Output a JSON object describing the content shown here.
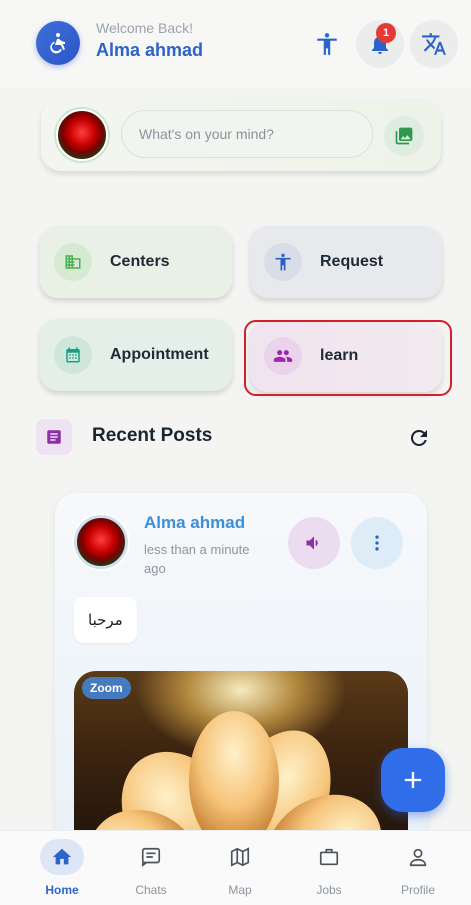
{
  "header": {
    "welcome": "Welcome Back!",
    "username": "Alma ahmad",
    "notification_count": "1",
    "icons": {
      "avatar": "wheelchair-icon",
      "accessibility": "accessibility-icon",
      "notifications": "bell-icon",
      "translate": "translate-icon"
    }
  },
  "composer": {
    "placeholder": "What's on your mind?",
    "photo_icon": "image-icon"
  },
  "quick_actions": [
    {
      "label": "Centers",
      "icon": "building-icon",
      "color": "#4caf50"
    },
    {
      "label": "Request",
      "icon": "accessibility-icon",
      "color": "#2d5fc4"
    },
    {
      "label": "Appointment",
      "icon": "calendar-icon",
      "color": "#16a085"
    },
    {
      "label": "learn",
      "icon": "people-icon",
      "color": "#9c27b0"
    }
  ],
  "recent_posts": {
    "title": "Recent Posts",
    "icon": "article-icon",
    "refresh_icon": "refresh-icon"
  },
  "post": {
    "author": "Alma ahmad",
    "time": "less than a minute ago",
    "text": "مرحبا",
    "zoom_label": "Zoom"
  },
  "bottom_nav": [
    {
      "label": "Home",
      "icon": "home-icon",
      "active": true
    },
    {
      "label": "Chats",
      "icon": "chat-icon",
      "active": false
    },
    {
      "label": "Map",
      "icon": "map-icon",
      "active": false
    },
    {
      "label": "Jobs",
      "icon": "briefcase-icon",
      "active": false
    },
    {
      "label": "Profile",
      "icon": "person-icon",
      "active": false
    }
  ],
  "colors": {
    "primary": "#2b63c9",
    "accent_fab": "#2f6ee8",
    "highlight": "#d21f2b"
  }
}
